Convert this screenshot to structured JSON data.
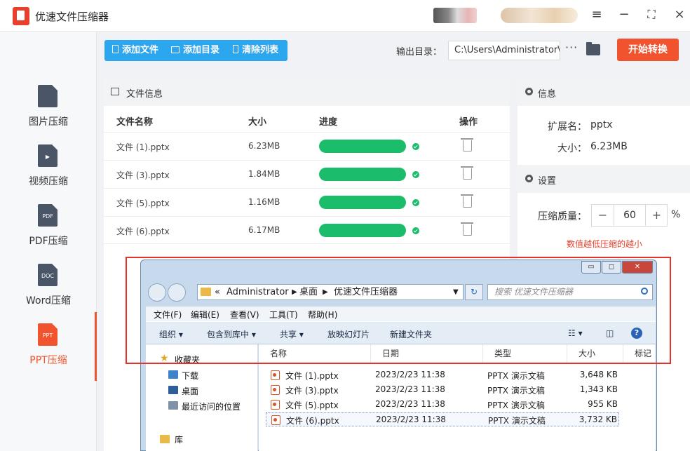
{
  "app": {
    "title": "优速文件压缩器"
  },
  "titlebar": {
    "menu_icon": "hamburger-icon",
    "minimize_icon": "minimize-icon",
    "maximize_icon": "maximize-icon",
    "close_icon": "close-icon"
  },
  "sidebar": {
    "items": [
      {
        "label": "图片压缩",
        "icon": "image-file-icon",
        "badge": ""
      },
      {
        "label": "视频压缩",
        "icon": "video-file-icon",
        "badge": "▶"
      },
      {
        "label": "PDF压缩",
        "icon": "pdf-file-icon",
        "badge": "PDF"
      },
      {
        "label": "Word压缩",
        "icon": "doc-file-icon",
        "badge": "DOC"
      },
      {
        "label": "PPT压缩",
        "icon": "ppt-file-icon",
        "badge": "PPT",
        "active": true
      }
    ]
  },
  "toolbar": {
    "add_file": "添加文件",
    "add_dir": "添加目录",
    "clear_list": "清除列表",
    "output_label": "输出目录：",
    "output_path": "C:\\Users\\Administrator\\",
    "more": "···",
    "start": "开始转换"
  },
  "file_panel": {
    "title": "文件信息",
    "columns": [
      "文件名称",
      "大小",
      "进度",
      "操作"
    ],
    "rows": [
      {
        "name": "文件 (1).pptx",
        "size": "6.23MB",
        "progress": 1.0
      },
      {
        "name": "文件 (3).pptx",
        "size": "1.84MB",
        "progress": 1.0
      },
      {
        "name": "文件 (5).pptx",
        "size": "1.16MB",
        "progress": 1.0
      },
      {
        "name": "文件 (6).pptx",
        "size": "6.17MB",
        "progress": 1.0
      }
    ]
  },
  "info_panel": {
    "title": "信息",
    "ext_label": "扩展名：",
    "ext_value": "pptx",
    "size_label": "大小：",
    "size_value": "6.23MB",
    "settings_title": "设置",
    "quality_label": "压缩质量：",
    "quality_value": "60",
    "minus": "−",
    "plus": "+",
    "percent": "%",
    "tip": "数值越低压缩的越小"
  },
  "explorer": {
    "address": {
      "prefix": "«",
      "crumbs": [
        "Administrator",
        "桌面",
        "优速文件压缩器"
      ]
    },
    "search_placeholder": "搜索 优速文件压缩器",
    "menu": [
      "文件(F)",
      "编辑(E)",
      "查看(V)",
      "工具(T)",
      "帮助(H)"
    ],
    "commands": [
      "组织 ▾",
      "包含到库中 ▾",
      "共享 ▾",
      "放映幻灯片",
      "新建文件夹"
    ],
    "help": "?",
    "nav": {
      "favorites": "收藏夹",
      "downloads": "下载",
      "desktop": "桌面",
      "recent": "最近访问的位置",
      "library": "库"
    },
    "columns": [
      "名称",
      "日期",
      "类型",
      "大小",
      "标记"
    ],
    "files": [
      {
        "name": "文件 (1).pptx",
        "date": "2023/2/23 11:38",
        "type": "PPTX 演示文稿",
        "size": "3,648 KB"
      },
      {
        "name": "文件 (3).pptx",
        "date": "2023/2/23 11:38",
        "type": "PPTX 演示文稿",
        "size": "1,343 KB"
      },
      {
        "name": "文件 (5).pptx",
        "date": "2023/2/23 11:38",
        "type": "PPTX 演示文稿",
        "size": "955 KB"
      },
      {
        "name": "文件 (6).pptx",
        "date": "2023/2/23 11:38",
        "type": "PPTX 演示文稿",
        "size": "3,732 KB"
      }
    ]
  },
  "colors": {
    "accent": "#f0532e",
    "toolbar_blue": "#2da6f0",
    "progress_green": "#1bbd6b",
    "highlight_red": "#e4312b"
  }
}
